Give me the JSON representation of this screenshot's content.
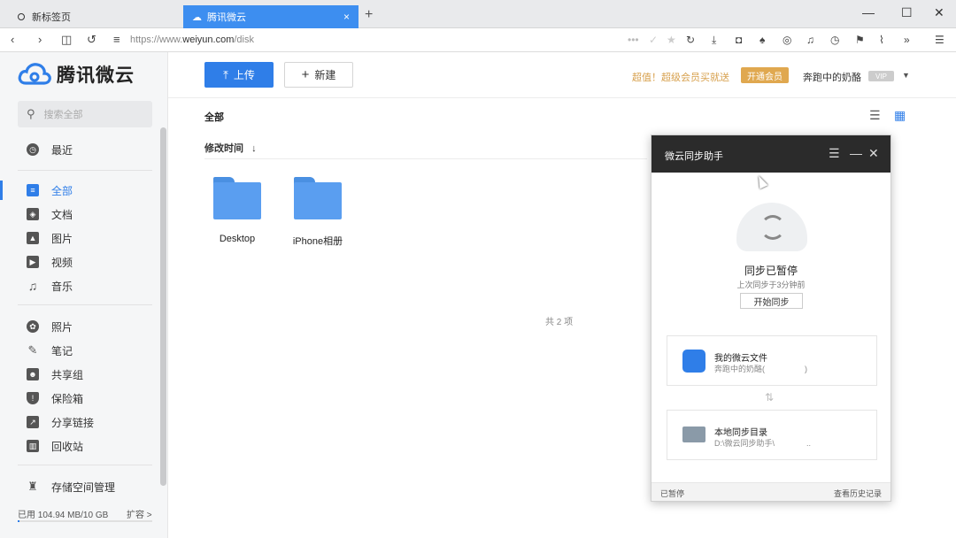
{
  "browser": {
    "tabs": [
      {
        "label": "新标签页"
      },
      {
        "label": "腾讯微云"
      }
    ],
    "url_prefix": "https://www.",
    "url_domain": "weiyun.com",
    "url_path": "/disk",
    "window_controls": {
      "minimize": "—",
      "maximize": "☐",
      "close": "✕"
    }
  },
  "app": {
    "brand": "腾讯微云",
    "search_placeholder": "搜索全部",
    "nav_primary": [
      {
        "label": "最近",
        "icon": "clock-icon"
      }
    ],
    "nav_files": [
      {
        "label": "全部",
        "icon": "all-files-icon",
        "active": true
      },
      {
        "label": "文档",
        "icon": "document-icon"
      },
      {
        "label": "图片",
        "icon": "image-icon"
      },
      {
        "label": "视频",
        "icon": "video-icon"
      },
      {
        "label": "音乐",
        "icon": "music-icon"
      }
    ],
    "nav_more": [
      {
        "label": "照片",
        "icon": "photo-icon"
      },
      {
        "label": "笔记",
        "icon": "note-icon"
      },
      {
        "label": "共享组",
        "icon": "share-group-icon"
      },
      {
        "label": "保险箱",
        "icon": "safe-icon"
      },
      {
        "label": "分享链接",
        "icon": "share-link-icon"
      },
      {
        "label": "回收站",
        "icon": "trash-icon"
      }
    ],
    "storage_manage": "存储空间管理",
    "storage_used": "已用 104.94 MB/10 GB",
    "storage_fraction": 0.01,
    "expand": "扩容 >"
  },
  "toolbar": {
    "upload": "上传",
    "new": "新建",
    "promo": "超值！超级会员买就送",
    "vip_button": "开通会员",
    "username": "奔跑中的奶酪",
    "vip_badge": "VIP"
  },
  "content": {
    "breadcrumb": "全部",
    "sort_label": "修改时间",
    "folders": [
      {
        "name": "Desktop"
      },
      {
        "name": "iPhone相册"
      }
    ],
    "count": "共 2 项"
  },
  "sync_dialog": {
    "title": "微云同步助手",
    "status": "同步已暂停",
    "last_sync": "上次同步于3分钟前",
    "start_button": "开始同步",
    "cloud_card": {
      "title": "我的微云文件",
      "subtitle": "奔跑中的奶酪(　　　　　)"
    },
    "local_card": {
      "title": "本地同步目录",
      "subtitle": "D:\\微云同步助手\\　　　　.."
    },
    "footer_status": "已暂停",
    "footer_history": "查看历史记录"
  },
  "colors": {
    "accent": "#2f7ee8",
    "promo": "#d7a04d",
    "dialog_header": "#2b2b2b"
  }
}
